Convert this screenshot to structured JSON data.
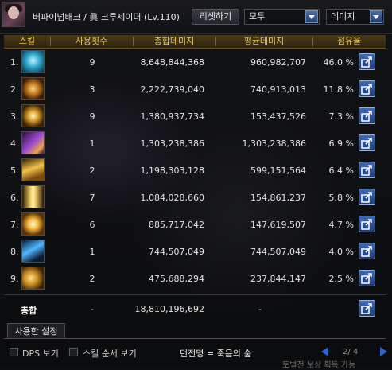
{
  "header": {
    "character_name": "버파이넘배크 / 眞 크루세이더",
    "level": "(Lv.110)",
    "reset_label": "리셋하기",
    "filter_select": "모두",
    "sort_select": "데미지"
  },
  "columns": {
    "skill": "스킬",
    "uses": "사용횟수",
    "total_damage": "총합데미지",
    "avg_damage": "평균데미지",
    "share": "점유율"
  },
  "rows": [
    {
      "index": "1.",
      "icon": "skill-icon-blue-beam",
      "uses": "9",
      "total": "8,648,844,368",
      "avg": "960,982,707",
      "share": "46.0 %"
    },
    {
      "index": "2.",
      "icon": "skill-icon-golden-wheel",
      "uses": "3",
      "total": "2,222,739,040",
      "avg": "740,913,013",
      "share": "11.8 %"
    },
    {
      "index": "3.",
      "icon": "skill-icon-holy-cross",
      "uses": "9",
      "total": "1,380,937,734",
      "avg": "153,437,526",
      "share": "7.3 %"
    },
    {
      "index": "4.",
      "icon": "skill-icon-purple-rune",
      "uses": "1",
      "total": "1,303,238,386",
      "avg": "1,303,238,386",
      "share": "6.9 %"
    },
    {
      "index": "5.",
      "icon": "skill-icon-golden-strike",
      "uses": "2",
      "total": "1,198,303,128",
      "avg": "599,151,564",
      "share": "6.4 %"
    },
    {
      "index": "6.",
      "icon": "skill-icon-light-pillar",
      "uses": "7",
      "total": "1,084,028,660",
      "avg": "154,861,237",
      "share": "5.8 %"
    },
    {
      "index": "7.",
      "icon": "skill-icon-sun-burst",
      "uses": "6",
      "total": "885,717,042",
      "avg": "147,619,507",
      "share": "4.7 %"
    },
    {
      "index": "8.",
      "icon": "skill-icon-blue-lightning",
      "uses": "1",
      "total": "744,507,049",
      "avg": "744,507,049",
      "share": "4.0 %"
    },
    {
      "index": "9.",
      "icon": "skill-icon-golden-wing",
      "uses": "2",
      "total": "475,688,294",
      "avg": "237,844,147",
      "share": "2.5 %"
    }
  ],
  "total": {
    "label": "총합",
    "uses": "-",
    "total": "18,810,196,692",
    "avg": "-"
  },
  "tab_used_settings": "사용한 설정",
  "footer": {
    "dps_label": "DPS 보기",
    "order_label": "스킬 순서 보기",
    "dungeon": "던전명 = 죽음의 숲",
    "page": "2/ 4",
    "bottom_text": "토벌전 보상 획득 가능"
  },
  "colors": {
    "header_gold": "#e9c860",
    "accent_blue": "#2d65c8"
  }
}
